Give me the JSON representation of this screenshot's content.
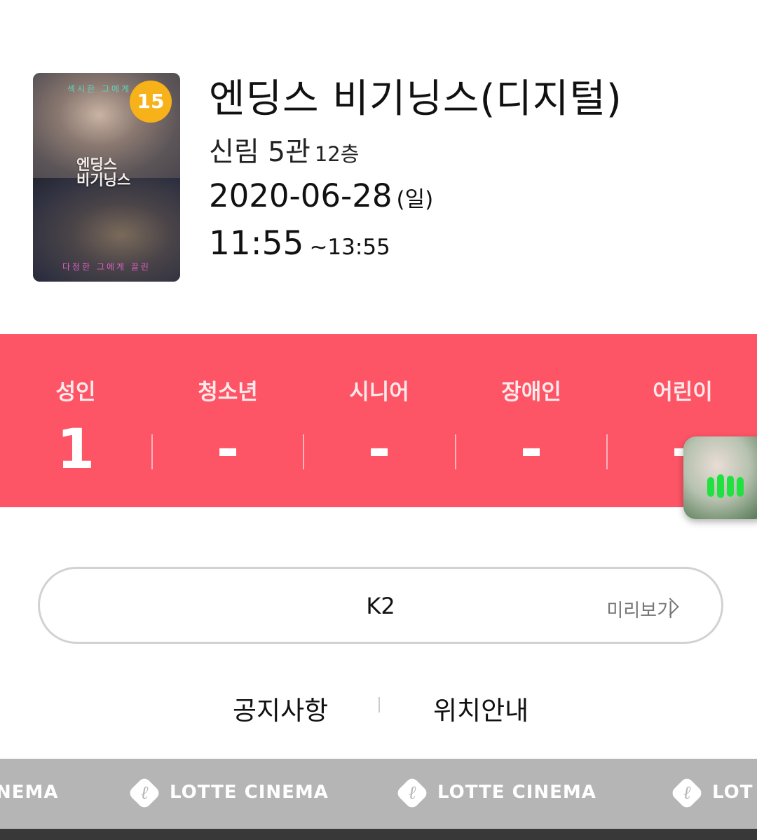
{
  "movie": {
    "rating": "15",
    "title": "엔딩스 비기닝스(디지털)",
    "theater": "신림 5관",
    "floor": "12층",
    "date": "2020-06-28",
    "day_of_week": "(일)",
    "start_time": "11:55",
    "end_time": "~13:55",
    "poster": {
      "title_line1": "엔딩스",
      "title_line2": "비기닝스",
      "tagline_top": "섹시한 그에게 흔",
      "tagline_bottom": "다정한 그에게 끌린"
    }
  },
  "tickets": [
    {
      "label": "성인",
      "count": "1"
    },
    {
      "label": "청소년",
      "count": "-"
    },
    {
      "label": "시니어",
      "count": "-"
    },
    {
      "label": "장애인",
      "count": "-"
    },
    {
      "label": "어린이",
      "count": "-"
    }
  ],
  "seat_section": {
    "screen_name": "K2",
    "preview_label": "미리보기"
  },
  "links": {
    "notice": "공지사항",
    "location": "위치안내"
  },
  "banner": {
    "logo_partial_left": "NEMA",
    "logo_text": "LOTTE CINEMA",
    "logo_partial_right": "LOT"
  },
  "colors": {
    "ticket_bar": "#fd5466",
    "rating_badge": "#f7b21a",
    "banner": "#b5b5b5",
    "player_eq": "#20e140"
  }
}
